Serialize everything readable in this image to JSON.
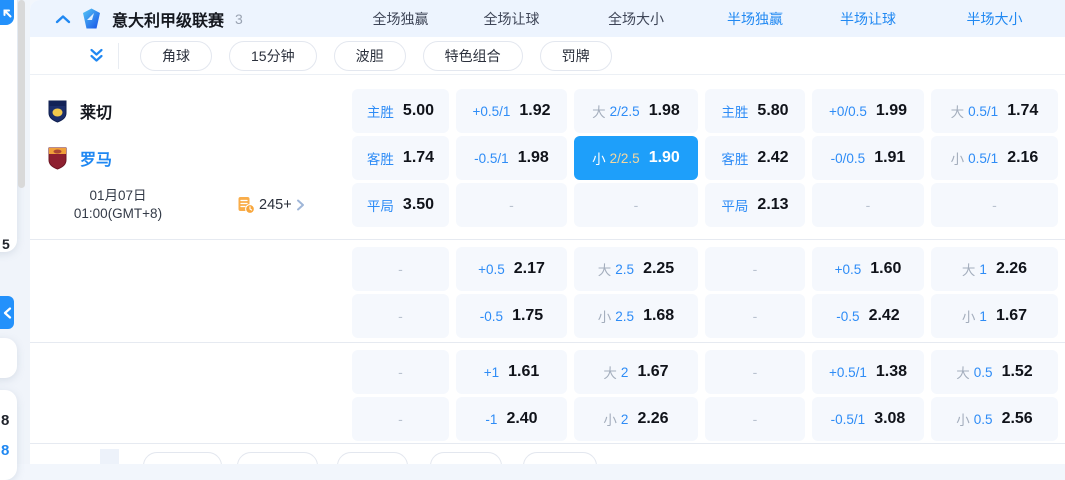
{
  "header": {
    "league": "意大利甲级联赛",
    "match_count": "3",
    "columns": [
      {
        "label": "全场独赢"
      },
      {
        "label": "全场让球"
      },
      {
        "label": "全场大小"
      },
      {
        "label": "半场独赢"
      },
      {
        "label": "半场让球"
      },
      {
        "label": "半场大小"
      }
    ]
  },
  "subtabs": [
    "角球",
    "15分钟",
    "波胆",
    "特色组合",
    "罚牌"
  ],
  "match": {
    "home_team": "莱切",
    "away_team": "罗马",
    "date": "01月07日",
    "time": "01:00(GMT+8)",
    "markets_count": "245+"
  },
  "odds": [
    [
      {
        "label": "主胜",
        "value": "5.00"
      },
      {
        "label": "+0.5/1",
        "value": "1.92"
      },
      {
        "label": "大",
        "line": "2/2.5",
        "value": "1.98"
      },
      {
        "label": "主胜",
        "value": "5.80"
      },
      {
        "label": "+0/0.5",
        "value": "1.99"
      },
      {
        "label": "大",
        "line": "0.5/1",
        "value": "1.74"
      }
    ],
    [
      {
        "label": "客胜",
        "value": "1.74"
      },
      {
        "label": "-0.5/1",
        "value": "1.98"
      },
      {
        "label": "小",
        "line": "2/2.5",
        "value": "1.90",
        "selected": true
      },
      {
        "label": "客胜",
        "value": "2.42"
      },
      {
        "label": "-0/0.5",
        "value": "1.91"
      },
      {
        "label": "小",
        "line": "0.5/1",
        "value": "2.16"
      }
    ],
    [
      {
        "label": "平局",
        "value": "3.50"
      },
      {
        "value": "-"
      },
      {
        "value": "-"
      },
      {
        "label": "平局",
        "value": "2.13"
      },
      {
        "value": "-"
      },
      {
        "value": "-"
      }
    ],
    [
      {
        "value": "-"
      },
      {
        "label": "+0.5",
        "value": "2.17"
      },
      {
        "label": "大",
        "line": "2.5",
        "value": "2.25"
      },
      {
        "value": "-"
      },
      {
        "label": "+0.5",
        "value": "1.60"
      },
      {
        "label": "大",
        "line": "1",
        "value": "2.26"
      }
    ],
    [
      {
        "value": "-"
      },
      {
        "label": "-0.5",
        "value": "1.75"
      },
      {
        "label": "小",
        "line": "2.5",
        "value": "1.68"
      },
      {
        "value": "-"
      },
      {
        "label": "-0.5",
        "value": "2.42"
      },
      {
        "label": "小",
        "line": "1",
        "value": "1.67"
      }
    ],
    [
      {
        "value": "-"
      },
      {
        "label": "+1",
        "value": "1.61"
      },
      {
        "label": "大",
        "line": "2",
        "value": "1.67"
      },
      {
        "value": "-"
      },
      {
        "label": "+0.5/1",
        "value": "1.38"
      },
      {
        "label": "大",
        "line": "0.5",
        "value": "1.52"
      }
    ],
    [
      {
        "value": "-"
      },
      {
        "label": "-1",
        "value": "2.40"
      },
      {
        "label": "小",
        "line": "2",
        "value": "2.26"
      },
      {
        "value": "-"
      },
      {
        "label": "-0.5/1",
        "value": "3.08"
      },
      {
        "label": "小",
        "line": "0.5",
        "value": "2.56"
      }
    ]
  ],
  "left_rail": {
    "fragments": [
      "5",
      "8",
      "8"
    ]
  },
  "colors": {
    "accent": "#2088f2",
    "selected_cell": "#1e9ffa",
    "markets_icon": "#f8a63b",
    "selected_line": "#f3d7a0"
  }
}
